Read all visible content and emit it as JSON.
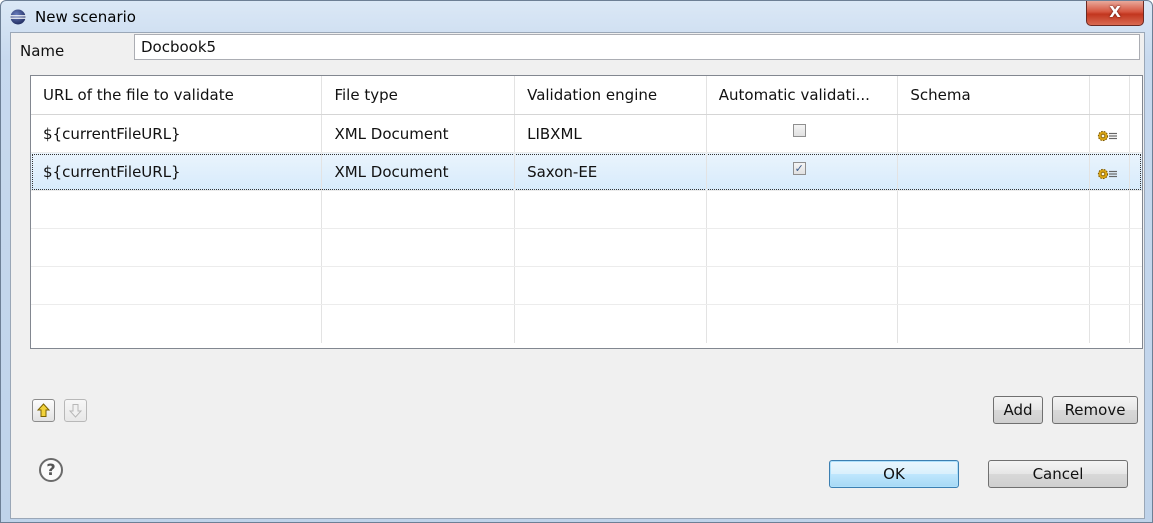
{
  "window": {
    "title": "New scenario",
    "close_label": "X"
  },
  "name_field": {
    "label": "Name",
    "value": "Docbook5"
  },
  "table": {
    "columns": [
      "URL of the file to validate",
      "File type",
      "Validation engine",
      "Automatic validati...",
      "Schema",
      "",
      ""
    ],
    "rows": [
      {
        "url": "${currentFileURL}",
        "file_type": "XML Document",
        "engine": "LIBXML",
        "automatic": false,
        "schema": ""
      },
      {
        "url": "${currentFileURL}",
        "file_type": "XML Document",
        "engine": "Saxon-EE",
        "automatic": true,
        "schema": ""
      }
    ],
    "empty_rows": 4,
    "selected_row": 1
  },
  "buttons": {
    "move_up_icon": "arrow-up-icon",
    "move_down_icon": "arrow-down-icon",
    "add": "Add",
    "remove": "Remove",
    "ok": "OK",
    "cancel": "Cancel",
    "help": "?"
  },
  "colors": {
    "selection": "#d7ebfb",
    "up_arrow": "#e8c21c"
  }
}
